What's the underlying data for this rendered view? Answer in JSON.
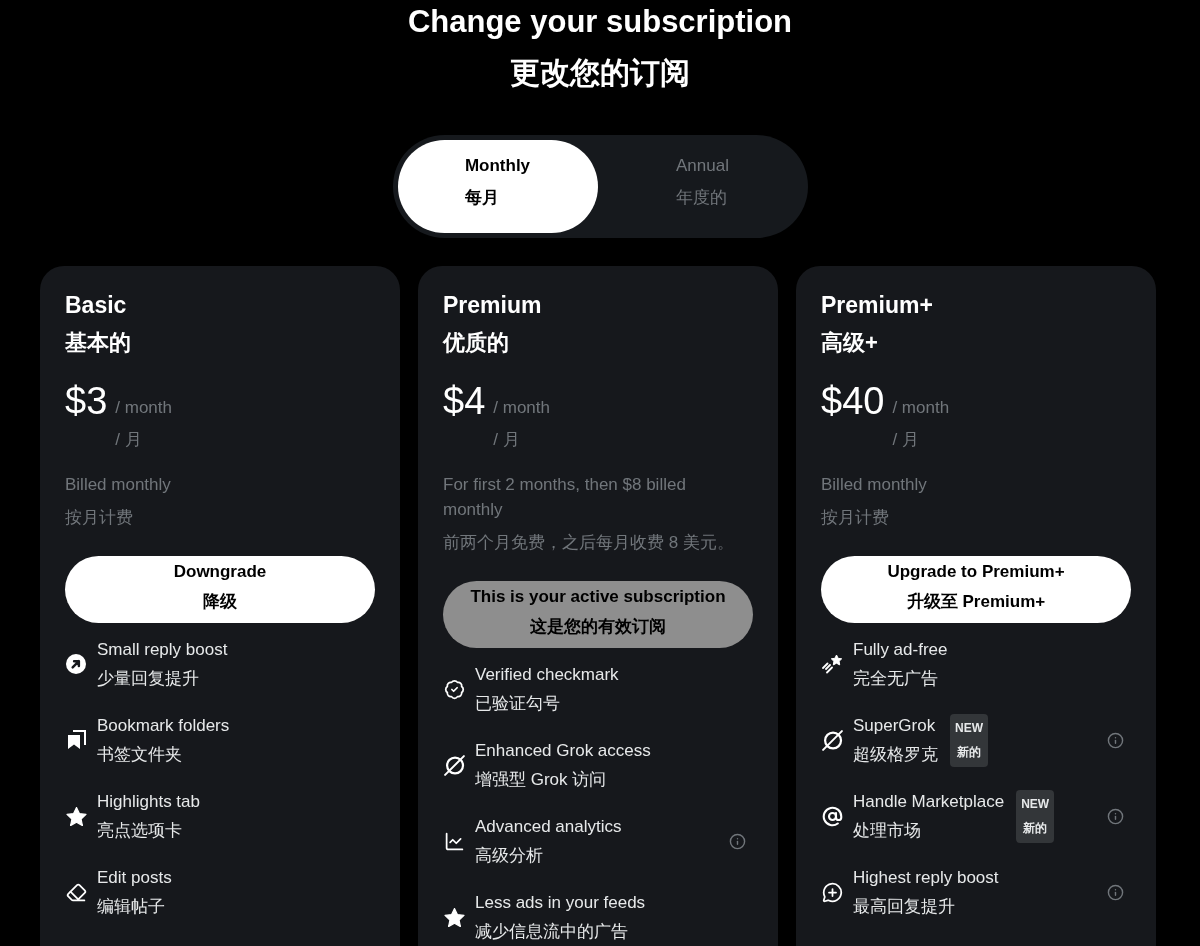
{
  "header": {
    "title": "Change your subscription",
    "title_zh": "更改您的订阅"
  },
  "billing_toggle": [
    {
      "label": "Monthly",
      "label_zh": "每月",
      "selected": true
    },
    {
      "label": "Annual",
      "label_zh": "年度的",
      "selected": false
    }
  ],
  "plans": [
    {
      "name": "Basic",
      "name_zh": "基本的",
      "price": "$3",
      "period": "/ month",
      "period_zh": "/ 月",
      "billing": "Billed monthly",
      "billing_zh": "按月计费",
      "button": {
        "kind": "action",
        "label": "Downgrade",
        "label_zh": "降级"
      },
      "features": [
        {
          "title": "Small reply boost",
          "title_zh": "少量回复提升",
          "info": false
        },
        {
          "title": "Bookmark folders",
          "title_zh": "书签文件夹",
          "info": false
        },
        {
          "title": "Highlights tab",
          "title_zh": "亮点选项卡",
          "info": false
        },
        {
          "title": "Edit posts",
          "title_zh": "编辑帖子",
          "info": false
        }
      ]
    },
    {
      "name": "Premium",
      "name_zh": "优质的",
      "price": "$4",
      "period": "/ month",
      "period_zh": "/ 月",
      "billing": "For first 2 months, then $8 billed monthly",
      "billing_zh": "前两个月免费，之后每月收费 8 美元。",
      "button": {
        "kind": "current",
        "label": "This is your active subscription",
        "label_zh": "这是您的有效订阅"
      },
      "features": [
        {
          "title": "Verified checkmark",
          "title_zh": "已验证勾号",
          "info": false
        },
        {
          "title": "Enhanced Grok access",
          "title_zh": "增强型 Grok 访问",
          "info": false
        },
        {
          "title": "Advanced analytics",
          "title_zh": "高级分析",
          "info": true
        },
        {
          "title": "Less ads in your feeds",
          "title_zh": "减少信息流中的广告",
          "info": false
        }
      ]
    },
    {
      "name": "Premium+",
      "name_zh": "高级+",
      "price": "$40",
      "period": "/ month",
      "period_zh": "/ 月",
      "billing": "Billed monthly",
      "billing_zh": "按月计费",
      "button": {
        "kind": "action",
        "label": "Upgrade to Premium+",
        "label_zh": "升级至 Premium+"
      },
      "features": [
        {
          "title": "Fully ad-free",
          "title_zh": "完全无广告",
          "info": false
        },
        {
          "title": "SuperGrok",
          "title_zh": "超级格罗克",
          "info": true,
          "badge": {
            "label": "NEW",
            "label_zh": "新的"
          }
        },
        {
          "title": "Handle Marketplace",
          "title_zh": "处理市场",
          "info": true,
          "badge": {
            "label": "NEW",
            "label_zh": "新的"
          }
        },
        {
          "title": "Highest reply boost",
          "title_zh": "最高回复提升",
          "info": true
        }
      ]
    }
  ]
}
